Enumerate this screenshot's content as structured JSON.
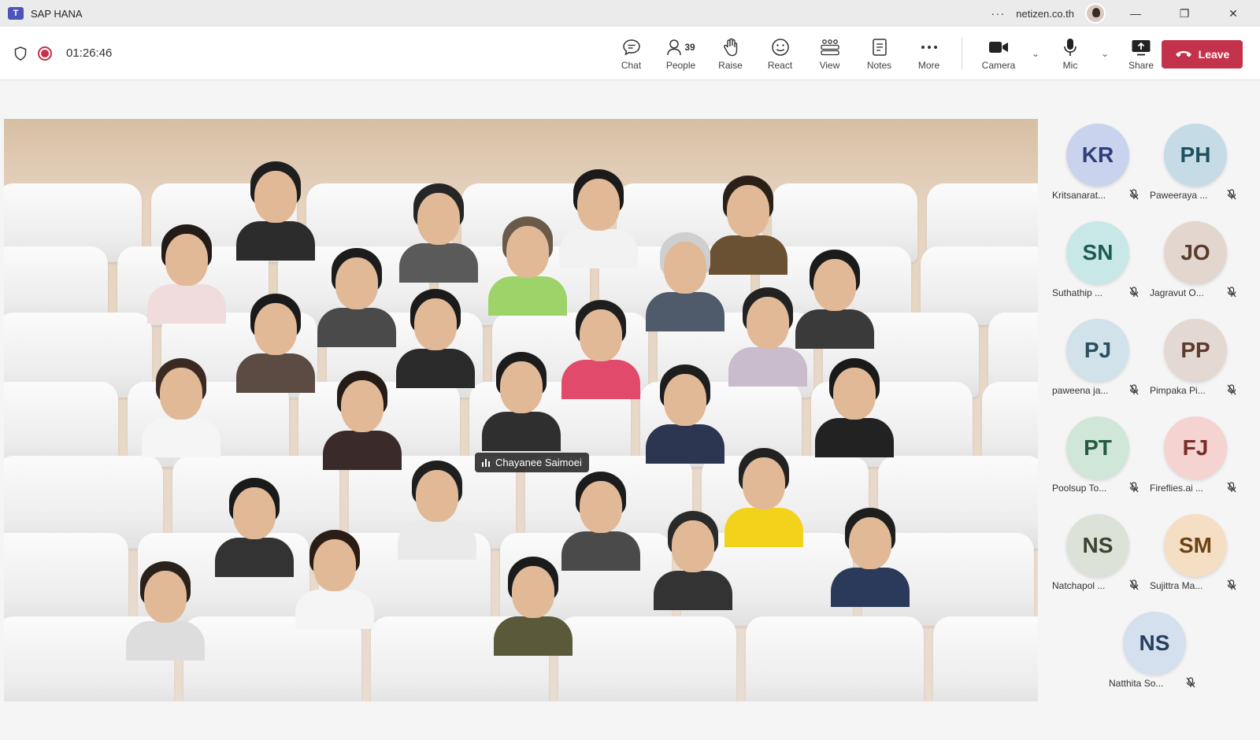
{
  "window": {
    "app_title": "SAP HANA",
    "more": "···",
    "org": "netizen.co.th",
    "minimize": "—",
    "restore": "❐",
    "close": "✕"
  },
  "status": {
    "timer": "01:26:46"
  },
  "toolbar": {
    "chat": "Chat",
    "people": "People",
    "people_count": "39",
    "raise": "Raise",
    "react": "React",
    "view": "View",
    "notes": "Notes",
    "more": "More",
    "camera": "Camera",
    "mic": "Mic",
    "share": "Share",
    "leave": "Leave"
  },
  "stage": {
    "active_speaker": "Chayanee Saimoei"
  },
  "roster": [
    {
      "initials": "KR",
      "name": "Kritsanarat...",
      "bg": "#c9d3ee",
      "fg": "#2f3e7a"
    },
    {
      "initials": "PH",
      "name": "Paweeraya ...",
      "bg": "#c5dce6",
      "fg": "#20505f"
    },
    {
      "initials": "SN",
      "name": "Suthathip ...",
      "bg": "#c7e8e6",
      "fg": "#1d5b57"
    },
    {
      "initials": "JO",
      "name": "Jagravut O...",
      "bg": "#e3d6ce",
      "fg": "#5a3c2c"
    },
    {
      "initials": "PJ",
      "name": "paweena ja...",
      "bg": "#d1e2ea",
      "fg": "#2a4f60"
    },
    {
      "initials": "PP",
      "name": "Pimpaka Pi...",
      "bg": "#e4d8d2",
      "fg": "#5c3a2e"
    },
    {
      "initials": "PT",
      "name": "Poolsup To...",
      "bg": "#cfe6d9",
      "fg": "#245c3d"
    },
    {
      "initials": "FJ",
      "name": "Fireflies.ai ...",
      "bg": "#f4d3d1",
      "fg": "#7a2c2a"
    },
    {
      "initials": "NS",
      "name": "Natchapol ...",
      "bg": "#dde2d8",
      "fg": "#3a4530"
    },
    {
      "initials": "SM",
      "name": "Sujittra Ma...",
      "bg": "#f5dfc4",
      "fg": "#6b4214"
    },
    {
      "initials": "NS",
      "name": "Natthita So...",
      "bg": "#d4e0ee",
      "fg": "#283f5e"
    }
  ]
}
